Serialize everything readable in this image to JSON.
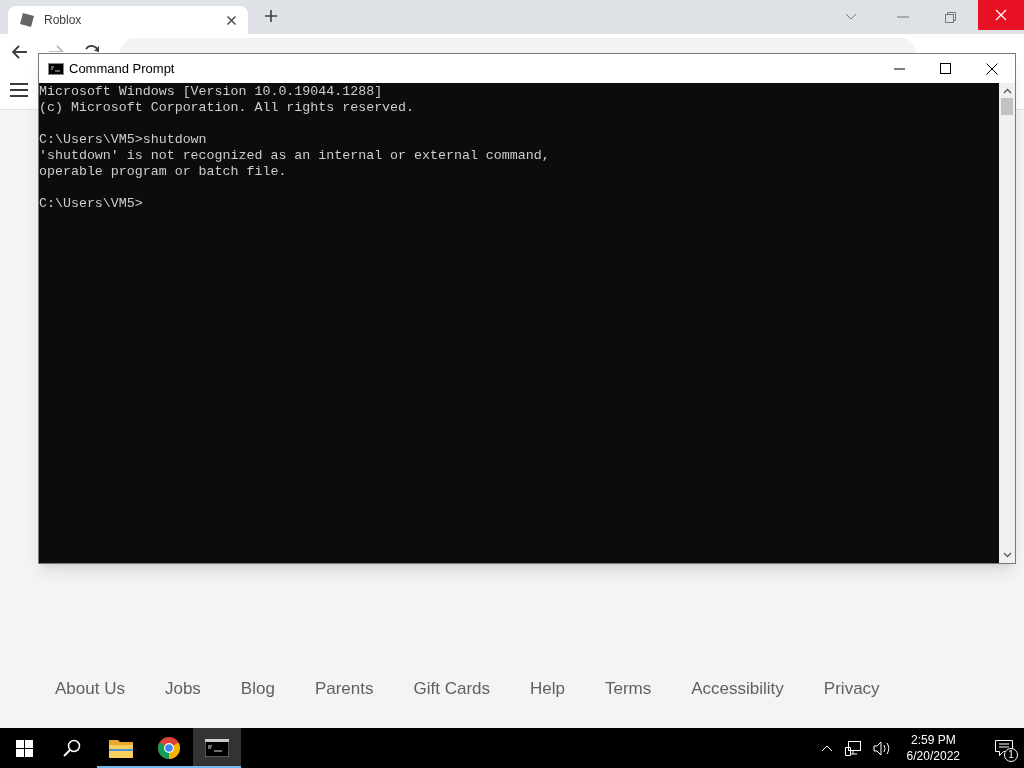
{
  "browser": {
    "tabs": [
      {
        "title": "Roblox",
        "selected": true
      }
    ]
  },
  "page": {
    "footer_links": [
      "About Us",
      "Jobs",
      "Blog",
      "Parents",
      "Gift Cards",
      "Help",
      "Terms",
      "Accessibility",
      "Privacy"
    ]
  },
  "console_window": {
    "title": "Command Prompt",
    "blocks": [
      [
        "Microsoft Windows [Version 10.0.19044.1288]",
        "(c) Microsoft Corporation. All rights reserved."
      ],
      [
        "C:\\Users\\VM5>shutdown",
        "'shutdown' is not recognized as an internal or external command,",
        "operable program or batch file."
      ],
      [
        "C:\\Users\\VM5>"
      ]
    ]
  },
  "taskbar": {
    "apps": [
      {
        "kind": "files",
        "running": true,
        "active": false
      },
      {
        "kind": "chrome",
        "running": true,
        "active": false
      },
      {
        "kind": "console",
        "running": true,
        "active": true
      }
    ],
    "time": "2:59 PM",
    "date": "6/20/2022",
    "notification_count": "1"
  }
}
